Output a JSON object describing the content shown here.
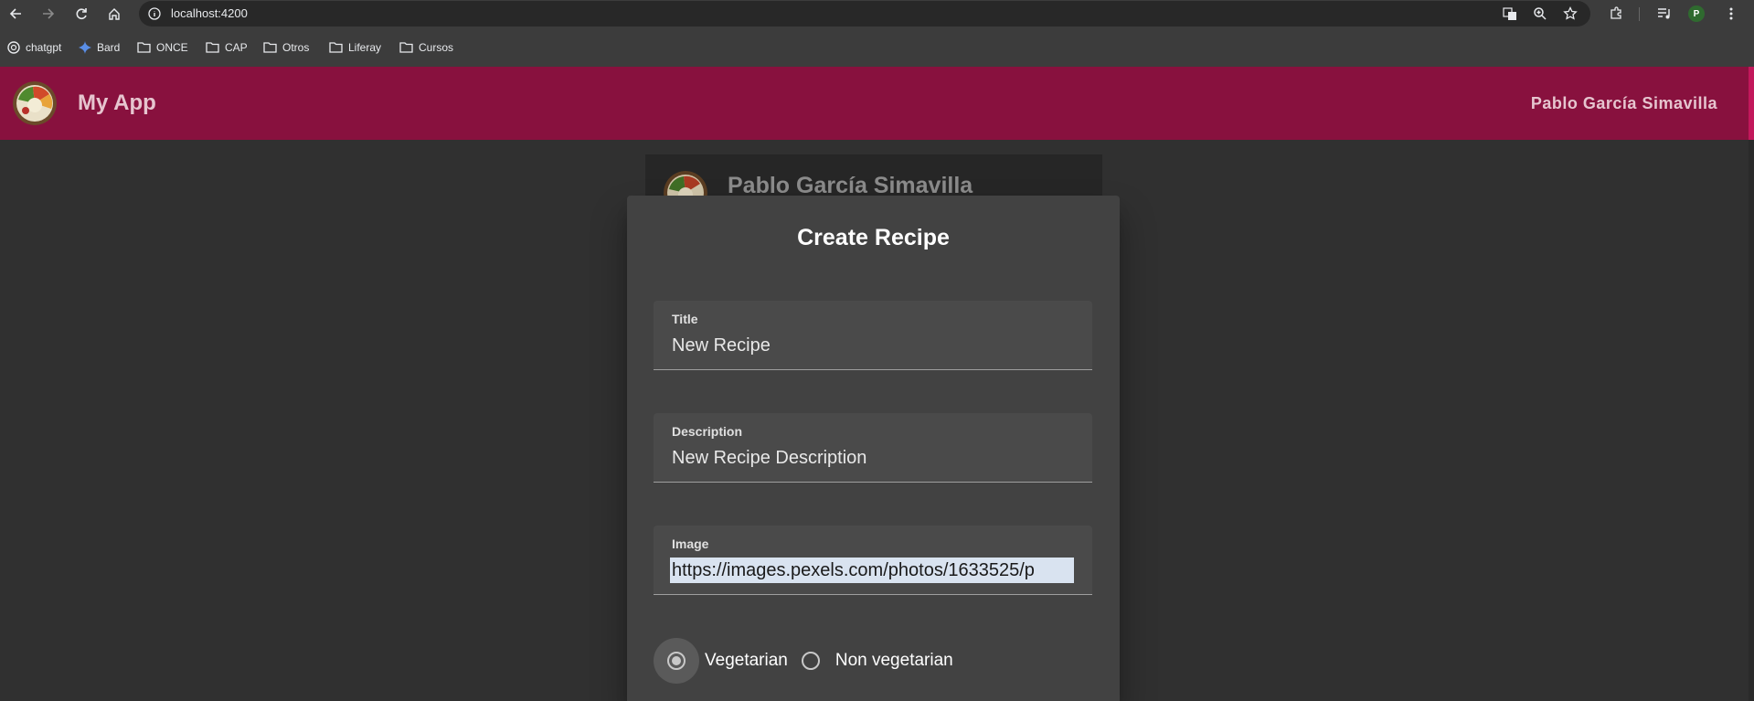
{
  "browser": {
    "url": "localhost:4200",
    "profile_initial": "P",
    "bookmarks": [
      {
        "label": "chatgpt",
        "icon": "chatgpt-icon"
      },
      {
        "label": "Bard",
        "icon": "bard-sparkle-icon"
      },
      {
        "label": "ONCE",
        "icon": "folder-icon"
      },
      {
        "label": "CAP",
        "icon": "folder-icon"
      },
      {
        "label": "Otros",
        "icon": "folder-icon"
      },
      {
        "label": "Liferay",
        "icon": "folder-icon"
      },
      {
        "label": "Cursos",
        "icon": "folder-icon"
      }
    ]
  },
  "app": {
    "title": "My App",
    "user_name": "Pablo García Simavilla",
    "accent_color": "#88113e"
  },
  "background_card": {
    "name": "Pablo García Simavilla"
  },
  "dialog": {
    "title": "Create Recipe",
    "fields": {
      "title": {
        "label": "Title",
        "value": "New Recipe"
      },
      "description": {
        "label": "Description",
        "value": "New Recipe Description"
      },
      "image": {
        "label": "Image",
        "value": "https://images.pexels.com/photos/1633525/p"
      }
    },
    "radio": {
      "options": [
        "Vegetarian",
        "Non vegetarian"
      ],
      "selected": "Vegetarian"
    }
  }
}
